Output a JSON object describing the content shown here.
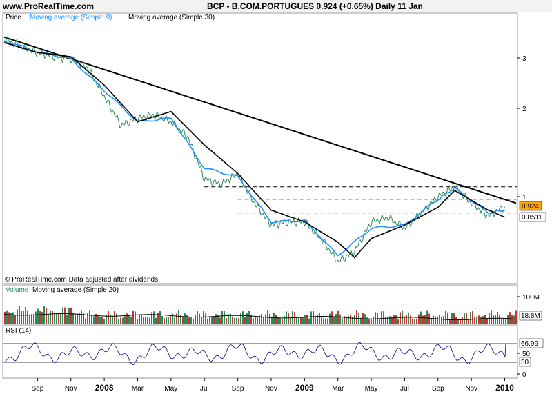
{
  "header": {
    "site": "www.ProRealTime.com",
    "title": "BCP - B.COM.PORTUGUES     0.924 (+0.65%)     Daily  11 Jan"
  },
  "price_panel": {
    "legend": [
      {
        "label": "Price",
        "color": "#000000"
      },
      {
        "label": "Moving average (Simple 9)",
        "color": "#1e90ff"
      },
      {
        "label": "Moving average (Simple 30)",
        "color": "#000000"
      }
    ],
    "footnote": "© ProRealTime.com  Data adjusted after dividends",
    "last_price": "0.924",
    "ma_value": "0.8511",
    "last_price_bg": "#ffa500"
  },
  "volume_panel": {
    "legend_volume": "Volume",
    "legend_ma": "Moving average (Simple 20)",
    "ticks": [
      "100M"
    ],
    "value": "18.8M"
  },
  "rsi_panel": {
    "legend": "RSI (14)",
    "ticks": [
      "50",
      "0"
    ],
    "value": "66.99",
    "lower": "30"
  },
  "x_axis": {
    "labels": [
      "Sep",
      "Nov",
      "2008",
      "Mar",
      "May",
      "Jul",
      "Sep",
      "Nov",
      "2009",
      "Mar",
      "May",
      "Jul",
      "Sep",
      "Nov",
      "2010"
    ]
  },
  "chart_data": {
    "type": "line",
    "title": "BCP - B.COM.PORTUGUES 0.924 (+0.65%) Daily 11 Jan",
    "y_scale": "log",
    "y_ticks": [
      "3",
      "2",
      "1"
    ],
    "x_ticks": [
      "Sep",
      "Nov",
      "2008",
      "Mar",
      "May",
      "Jul",
      "Sep",
      "Nov",
      "2009",
      "Mar",
      "May",
      "Jul",
      "Sep",
      "Nov",
      "2010"
    ],
    "series": [
      {
        "name": "Price",
        "points": [
          [
            "2007-07",
            3.45
          ],
          [
            "2007-08",
            3.25
          ],
          [
            "2007-09",
            3.1
          ],
          [
            "2007-10",
            3.0
          ],
          [
            "2007-11",
            2.95
          ],
          [
            "2007-12",
            2.75
          ],
          [
            "2008-01",
            2.2
          ],
          [
            "2008-02",
            1.75
          ],
          [
            "2008-03",
            1.85
          ],
          [
            "2008-04",
            1.9
          ],
          [
            "2008-05",
            1.8
          ],
          [
            "2008-06",
            1.6
          ],
          [
            "2008-07",
            1.15
          ],
          [
            "2008-08",
            1.1
          ],
          [
            "2008-09",
            1.2
          ],
          [
            "2008-10",
            0.95
          ],
          [
            "2008-11",
            0.8
          ],
          [
            "2008-12",
            0.82
          ],
          [
            "2009-01",
            0.82
          ],
          [
            "2009-02",
            0.72
          ],
          [
            "2009-03",
            0.6
          ],
          [
            "2009-04",
            0.65
          ],
          [
            "2009-05",
            0.82
          ],
          [
            "2009-06",
            0.85
          ],
          [
            "2009-07",
            0.78
          ],
          [
            "2009-08",
            0.88
          ],
          [
            "2009-09",
            1.0
          ],
          [
            "2009-10",
            1.08
          ],
          [
            "2009-11",
            0.95
          ],
          [
            "2009-12",
            0.86
          ],
          [
            "2010-01",
            0.924
          ]
        ]
      },
      {
        "name": "Moving average (Simple 9)",
        "points": [
          [
            "2007-07",
            3.4
          ],
          [
            "2007-09",
            3.12
          ],
          [
            "2007-11",
            2.95
          ],
          [
            "2008-01",
            2.3
          ],
          [
            "2008-03",
            1.8
          ],
          [
            "2008-05",
            1.85
          ],
          [
            "2008-07",
            1.25
          ],
          [
            "2008-09",
            1.17
          ],
          [
            "2008-11",
            0.82
          ],
          [
            "2009-01",
            0.83
          ],
          [
            "2009-03",
            0.63
          ],
          [
            "2009-05",
            0.78
          ],
          [
            "2009-07",
            0.8
          ],
          [
            "2009-09",
            0.98
          ],
          [
            "2009-10",
            1.07
          ],
          [
            "2009-12",
            0.88
          ],
          [
            "2010-01",
            0.9
          ]
        ]
      },
      {
        "name": "Moving average (Simple 30)",
        "points": [
          [
            "2007-07",
            3.35
          ],
          [
            "2007-09",
            3.1
          ],
          [
            "2007-11",
            3.0
          ],
          [
            "2008-01",
            2.4
          ],
          [
            "2008-03",
            1.8
          ],
          [
            "2008-05",
            1.95
          ],
          [
            "2008-07",
            1.5
          ],
          [
            "2008-09",
            1.2
          ],
          [
            "2008-11",
            0.9
          ],
          [
            "2009-01",
            0.82
          ],
          [
            "2009-03",
            0.7
          ],
          [
            "2009-04",
            0.62
          ],
          [
            "2009-05",
            0.72
          ],
          [
            "2009-07",
            0.8
          ],
          [
            "2009-09",
            0.92
          ],
          [
            "2009-10",
            1.05
          ],
          [
            "2009-12",
            0.9
          ],
          [
            "2010-01",
            0.8511
          ]
        ]
      }
    ],
    "trendline": [
      [
        "2007-07",
        3.5
      ],
      [
        "2010-01",
        0.95
      ]
    ],
    "horizontal_levels": [
      1.08,
      0.98,
      0.88
    ],
    "volume_ma_level": "18.8M",
    "rsi_levels": [
      70,
      30
    ],
    "rsi_last": 66.99,
    "grid": false,
    "legend_placement": "top-left"
  }
}
